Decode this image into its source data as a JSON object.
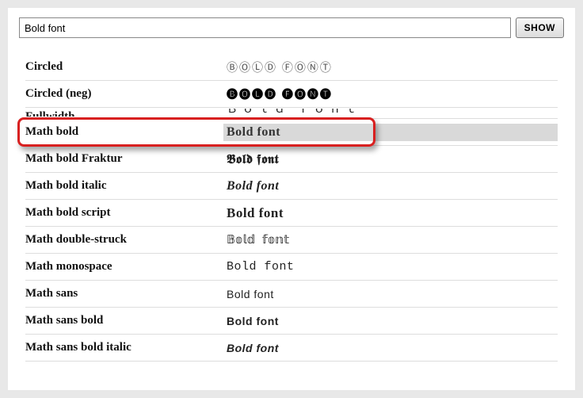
{
  "search": {
    "value": "Bold font"
  },
  "buttons": {
    "show": "SHOW"
  },
  "rows": [
    {
      "label": "Circled",
      "output": "ⒷⓄⓁⒹ ⒻⓄⓃⓉ",
      "cls": "s-circled"
    },
    {
      "label": "Circled (neg)",
      "output": "🅑🅞🅛🅓 🅕🅞🅝🅣",
      "cls": "s-circneg"
    },
    {
      "label": "Fullwidth",
      "output": "Ｂｏｌｄ ｆｏｎｔ",
      "cls": "s-fullw",
      "clip": true
    },
    {
      "label": "Math bold",
      "output": "Bold font",
      "cls": "s-mbold",
      "highlight": true,
      "selected": true
    },
    {
      "label": "Math bold Fraktur",
      "output": "𝕭𝖔𝖑𝖉 𝖋𝖔𝖓𝖙",
      "cls": "s-frak"
    },
    {
      "label": "Math bold italic",
      "output": "Bold font",
      "cls": "s-mbi"
    },
    {
      "label": "Math bold script",
      "output": "Bold font",
      "cls": "s-script"
    },
    {
      "label": "Math double-struck",
      "output": "𝔹𝕠𝕝𝕕 𝕗𝕠𝕟𝕥",
      "cls": "s-ds"
    },
    {
      "label": "Math monospace",
      "output": "Bold font",
      "cls": "s-mono"
    },
    {
      "label": "Math sans",
      "output": "Bold font",
      "cls": "s-sans"
    },
    {
      "label": "Math sans bold",
      "output": "Bold font",
      "cls": "s-sansb"
    },
    {
      "label": "Math sans bold italic",
      "output": "Bold font",
      "cls": "s-sansbi"
    }
  ]
}
